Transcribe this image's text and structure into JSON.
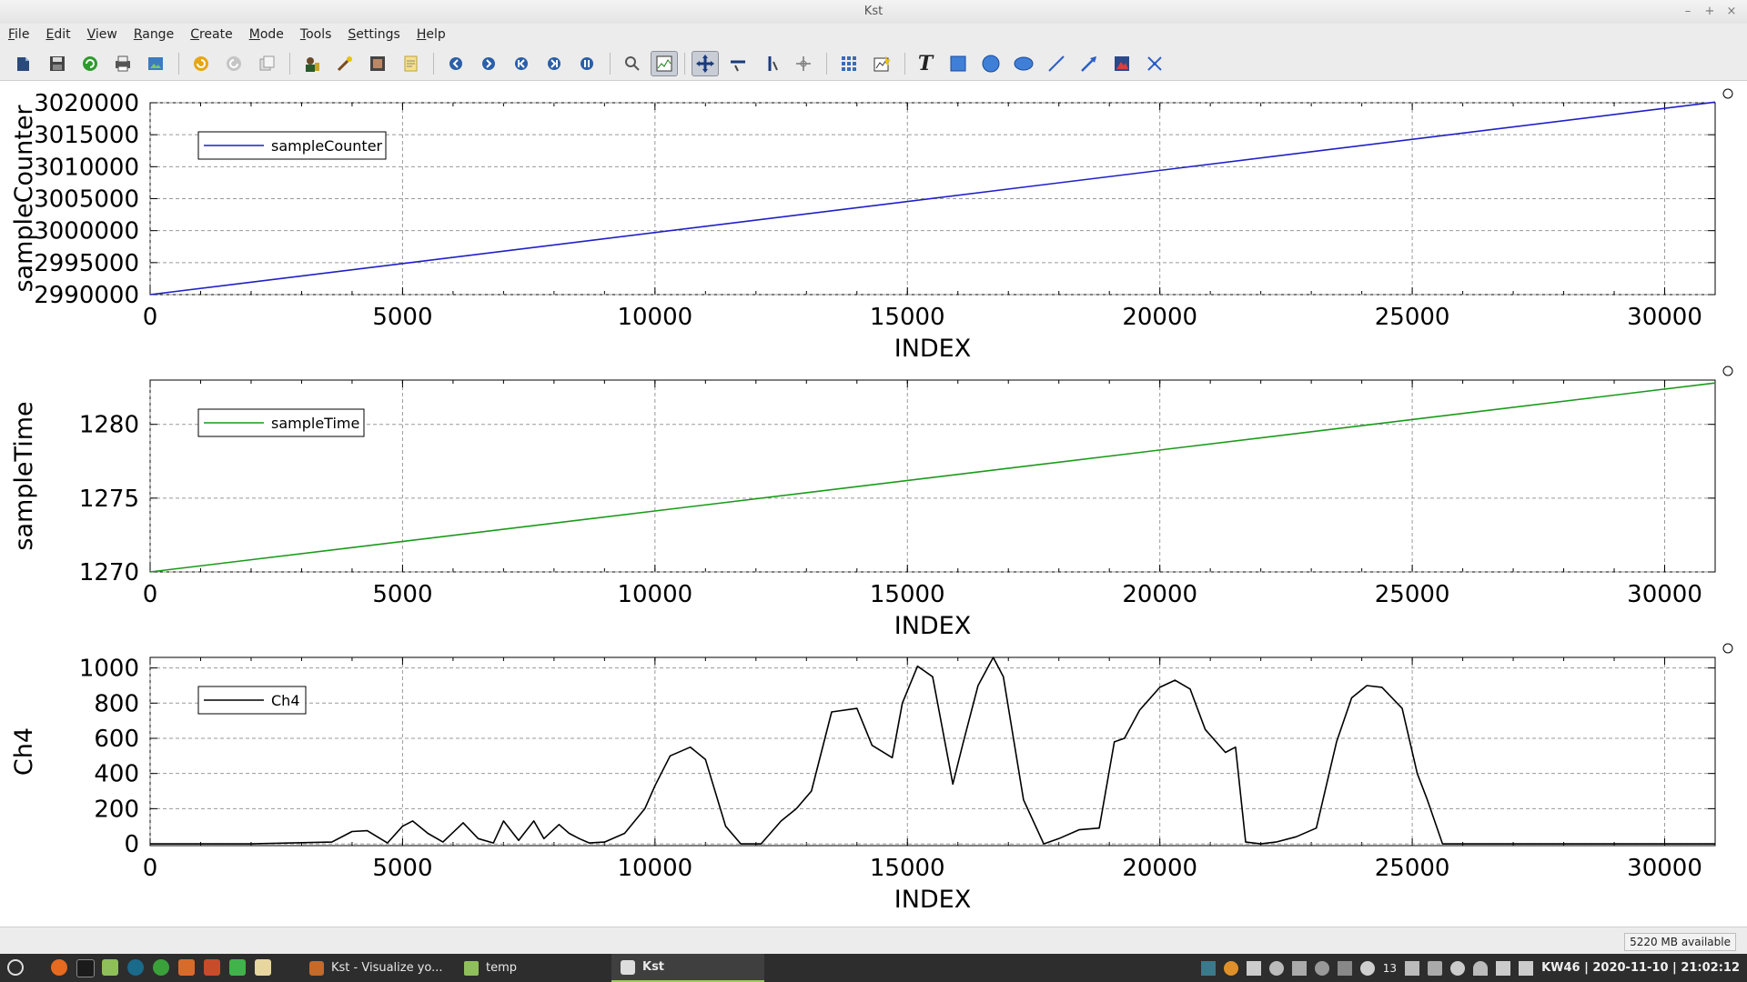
{
  "window": {
    "title": "Kst",
    "controls": [
      "–",
      "+",
      "×"
    ]
  },
  "menu": [
    "File",
    "Edit",
    "View",
    "Range",
    "Create",
    "Mode",
    "Tools",
    "Settings",
    "Help"
  ],
  "status": {
    "memory": "5220 MB available"
  },
  "taskbar": {
    "tasks": [
      {
        "label": "Kst - Visualize yo...",
        "active": false
      },
      {
        "label": "temp",
        "active": false
      },
      {
        "label": "Kst",
        "active": true
      }
    ],
    "tray_badge": "13",
    "clock": "KW46 | 2020-11-10 | 21:02:12"
  },
  "chart_data": [
    {
      "type": "line",
      "ylabel": "sampleCounter",
      "xlabel": "INDEX",
      "xlim": [
        0,
        31000
      ],
      "ylim": [
        2990000,
        3020000
      ],
      "xticks": [
        0,
        5000,
        10000,
        15000,
        20000,
        25000,
        30000
      ],
      "yticks": [
        2990000,
        2995000,
        3000000,
        3005000,
        3010000,
        3015000,
        3020000
      ],
      "grid": true,
      "legend": "top-left",
      "series": [
        {
          "name": "sampleCounter",
          "color": "#1f1fc8",
          "x": [
            0,
            31000
          ],
          "y": [
            2990000,
            3020100
          ]
        }
      ]
    },
    {
      "type": "line",
      "ylabel": "sampleTime",
      "xlabel": "INDEX",
      "xlim": [
        0,
        31000
      ],
      "ylim": [
        1270,
        1283
      ],
      "xticks": [
        0,
        5000,
        10000,
        15000,
        20000,
        25000,
        30000
      ],
      "yticks": [
        1270,
        1275,
        1280
      ],
      "grid": true,
      "legend": "top-left",
      "series": [
        {
          "name": "sampleTime",
          "color": "#1a9a1a",
          "x": [
            0,
            31000
          ],
          "y": [
            1270.0,
            1282.8
          ]
        }
      ]
    },
    {
      "type": "line",
      "ylabel": "Ch4",
      "xlabel": "INDEX",
      "xlim": [
        0,
        31000
      ],
      "ylim": [
        -10,
        1060
      ],
      "xticks": [
        0,
        5000,
        10000,
        15000,
        20000,
        25000,
        30000
      ],
      "yticks": [
        0,
        200,
        400,
        600,
        800,
        1000
      ],
      "grid": true,
      "legend": "top-left",
      "series": [
        {
          "name": "Ch4",
          "color": "#000000",
          "x": [
            0,
            2000,
            3600,
            4000,
            4300,
            4700,
            5000,
            5200,
            5500,
            5800,
            6200,
            6500,
            6800,
            7000,
            7300,
            7600,
            7800,
            8100,
            8300,
            8500,
            8700,
            9000,
            9400,
            9800,
            10000,
            10300,
            10700,
            11000,
            11400,
            11700,
            12100,
            12500,
            12800,
            13100,
            13500,
            14000,
            14300,
            14700,
            14900,
            15200,
            15500,
            15900,
            16100,
            16400,
            16700,
            16900,
            17300,
            17700,
            18000,
            18400,
            18800,
            19100,
            19300,
            19600,
            20000,
            20300,
            20600,
            20900,
            21300,
            21500,
            21700,
            22000,
            22300,
            22700,
            23100,
            23500,
            23800,
            24100,
            24400,
            24800,
            25100,
            25300,
            25600,
            28000,
            31000
          ],
          "y": [
            0,
            0,
            10,
            70,
            75,
            5,
            100,
            130,
            60,
            10,
            120,
            30,
            5,
            130,
            20,
            130,
            30,
            110,
            60,
            30,
            5,
            10,
            60,
            200,
            330,
            500,
            550,
            480,
            100,
            0,
            0,
            130,
            200,
            300,
            750,
            770,
            560,
            490,
            800,
            1010,
            950,
            340,
            570,
            900,
            1060,
            950,
            250,
            0,
            30,
            80,
            90,
            580,
            600,
            760,
            890,
            930,
            880,
            650,
            520,
            550,
            10,
            0,
            10,
            40,
            90,
            580,
            830,
            900,
            890,
            770,
            400,
            250,
            0,
            0,
            0
          ]
        }
      ]
    }
  ]
}
